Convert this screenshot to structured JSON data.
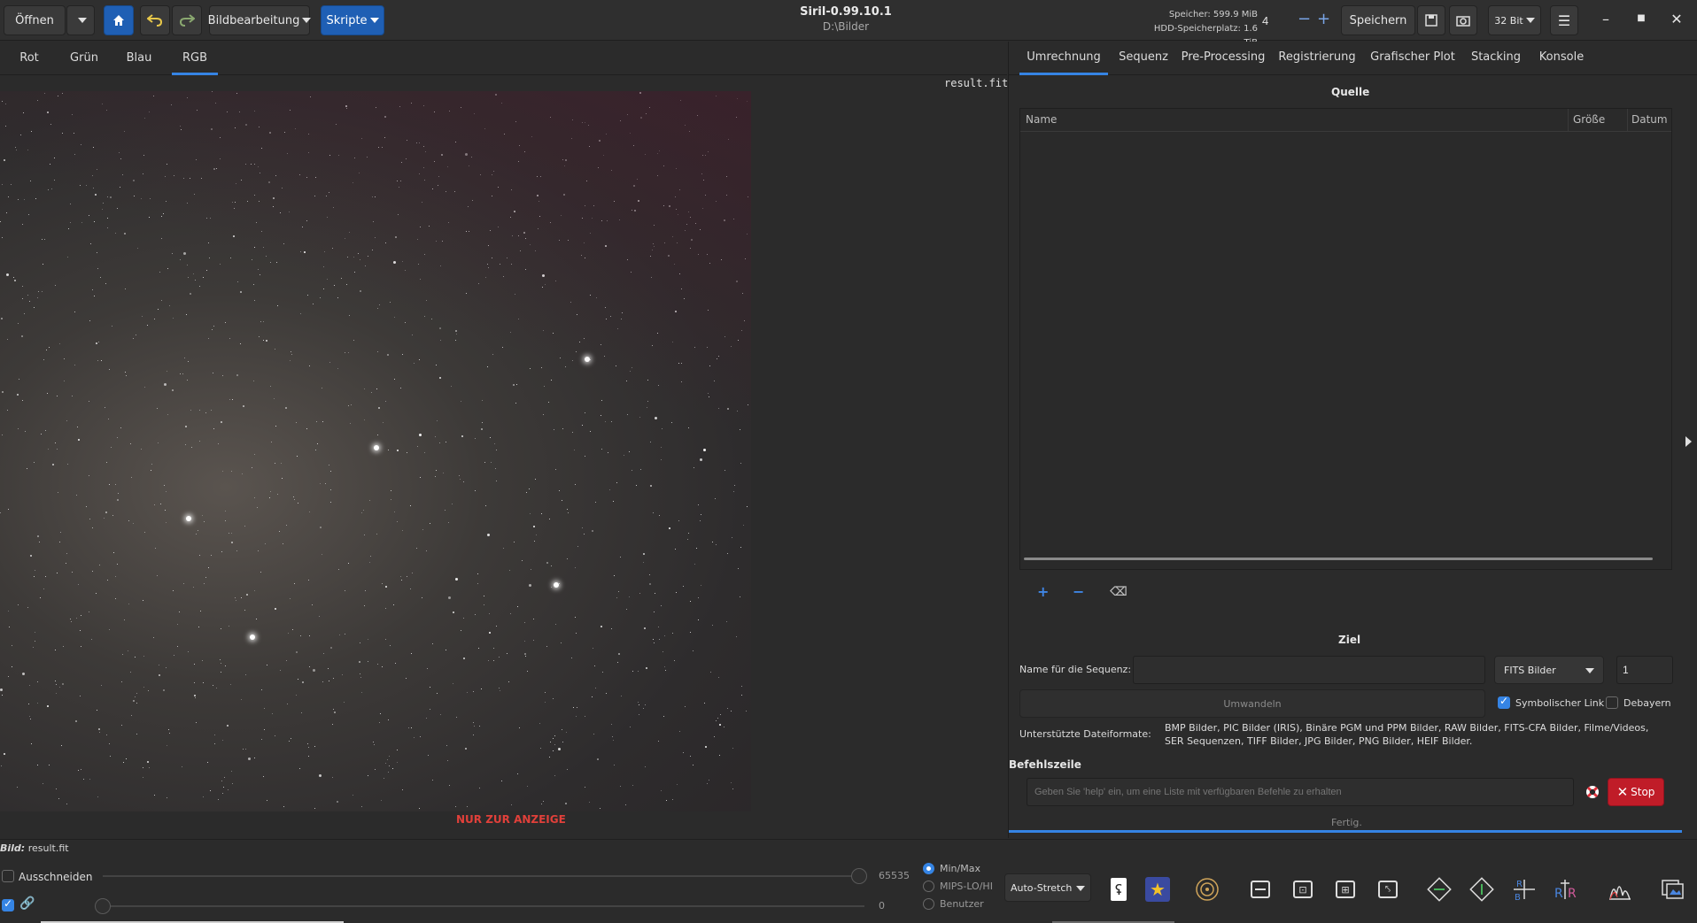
{
  "header": {
    "open_label": "Öffnen",
    "image_processing_label": "Bildbearbeitung",
    "scripts_label": "Skripte",
    "app_title": "Siril-0.99.10.1",
    "path": "D:\\Bilder",
    "memory": "Speicher: 599.9 MiB",
    "disk": "HDD-Speicherplatz: 1.6 TiB",
    "threads_value": "4",
    "save_label": "Speichern",
    "bitdepth_label": "32 Bit"
  },
  "channel_tabs": [
    "Rot",
    "Grün",
    "Blau",
    "RGB"
  ],
  "viewport": {
    "filename": "result.fit",
    "notice": "NUR ZUR ANZEIGE"
  },
  "right_tabs": [
    "Umrechnung",
    "Sequenz",
    "Pre-Processing",
    "Registrierung",
    "Grafischer Plot",
    "Stacking",
    "Konsole"
  ],
  "conversion": {
    "source_title": "Quelle",
    "columns": [
      "Name",
      "Größe",
      "Datum"
    ],
    "target_title": "Ziel",
    "sequence_name_label": "Name für die Sequenz:",
    "sequence_name_value": "",
    "format_value": "FITS Bilder",
    "start_index_value": "1",
    "convert_label": "Umwandeln",
    "symlink_label": "Symbolischer Link",
    "debayer_label": "Debayern",
    "supported_label": "Unterstützte Dateiformate:",
    "supported_formats": "BMP Bilder, PIC Bilder (IRIS), Binäre PGM und PPM Bilder, RAW Bilder, FITS-CFA Bilder, Filme/Videos, SER Sequenzen, TIFF Bilder, JPG Bilder, PNG Bilder, HEIF Bilder."
  },
  "command": {
    "title": "Befehlszeile",
    "placeholder": "Geben Sie 'help' ein, um eine Liste mit verfügbaren Befehle zu erhalten",
    "stop_label": "Stop",
    "status": "Fertig."
  },
  "bottom": {
    "image_label": "Bild:",
    "image_name": "result.fit",
    "crop_label": "Ausschneiden",
    "hi_value": "65535",
    "lo_value": "0",
    "radio_options": [
      "Min/Max",
      "MIPS-LO/HI",
      "Benutzer"
    ],
    "selected_radio": "Min/Max",
    "stretch_label": "Auto-Stretch"
  },
  "colors": {
    "accent": "#3584e4",
    "stop_red": "#c01c28",
    "notice_red": "#e0403a"
  }
}
